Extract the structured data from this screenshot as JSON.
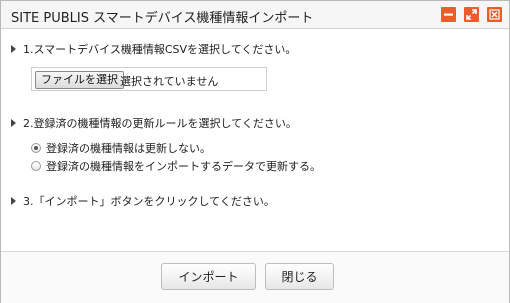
{
  "dialog": {
    "title": "SITE PUBLIS スマートデバイス機種情報インポート",
    "accent_color": "#ef5b2a",
    "window_buttons": [
      "minimize-icon",
      "maximize-icon",
      "close-icon"
    ]
  },
  "steps": {
    "step1": "1.スマートデバイス機種情報CSVを選択してください。",
    "step2": "2.登録済の機種情報の更新ルールを選択してください。",
    "step3": "3.「インポート」ボタンをクリックしてください。"
  },
  "file": {
    "button_label": "ファイルを選択",
    "status": "選択されていません"
  },
  "update_rule": {
    "options": [
      {
        "label": "登録済の機種情報は更新しない。",
        "checked": true
      },
      {
        "label": "登録済の機種情報をインポートするデータで更新する。",
        "checked": false
      }
    ]
  },
  "footer": {
    "import_label": "インポート",
    "close_label": "閉じる"
  }
}
